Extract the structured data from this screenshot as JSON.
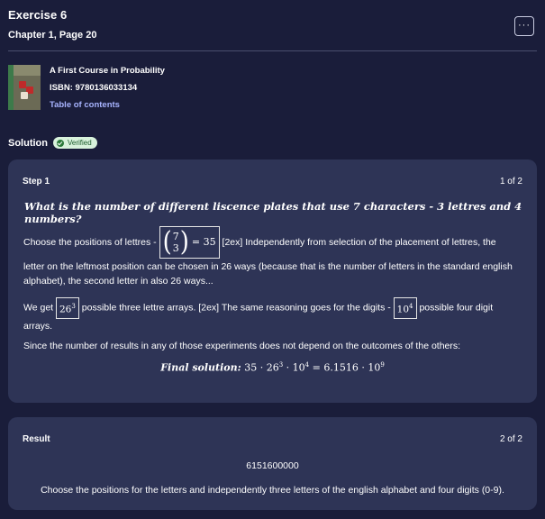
{
  "header": {
    "title": "Exercise 6",
    "subtitle": "Chapter 1, Page 20",
    "more_label": "···"
  },
  "book": {
    "title": "A First Course in Probability",
    "isbn": "ISBN: 9780136033134",
    "toc_link": "Table of contents",
    "cover_text": "A First Course in PROBABILITY"
  },
  "solution": {
    "label": "Solution",
    "badge": "Verified"
  },
  "step1": {
    "title": "Step 1",
    "count": "1 of 2",
    "question": "What is the number of different liscence plates that use 7 characters - 3 lettres and 4 numbers?",
    "p1_prefix": "Choose the positions of lettres -",
    "binom_top": "7",
    "binom_bottom": "3",
    "binom_result": "= 35",
    "p1_suffix": "[2ex] Independently from selection of the placement of lettres, the",
    "p1_cont": "letter on the leftmost position can be chosen in 26 ways (because that is the number of letters in the standard english alphabet), the second letter in also 26 ways...",
    "p2_prefix": "We get",
    "p2_box1_base": "26",
    "p2_box1_exp": "3",
    "p2_mid": "possible three lettre arrays. [2ex] The same reasoning goes for the digits -",
    "p2_box2_base": "10",
    "p2_box2_exp": "4",
    "p2_suffix": "possible four digit arrays.",
    "p3": "Since the number of results in any of those experiments does not depend on the outcomes of the others:",
    "final_label": "Final solution:",
    "final_expr_a": "35 · 26",
    "final_exp_a": "3",
    "final_expr_b": " · 10",
    "final_exp_b": "4",
    "final_expr_c": " = 6.1516 · 10",
    "final_exp_c": "9"
  },
  "result": {
    "title": "Result",
    "count": "2 of 2",
    "value": "6151600000",
    "text": "Choose the positions for the letters and independently three letters of the english alphabet and four digits (0-9)."
  }
}
